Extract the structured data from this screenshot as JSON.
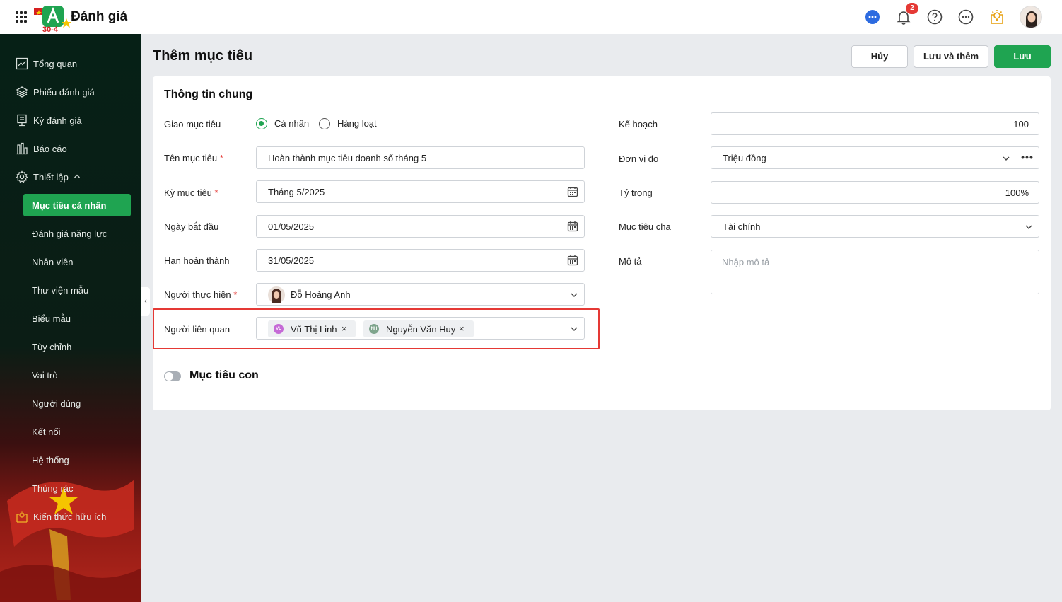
{
  "app": {
    "title": "Đánh giá",
    "logo_text": "30-4"
  },
  "topbar": {
    "notification_count": "2",
    "icons": [
      "chat-icon",
      "bell-icon",
      "help-icon",
      "more-icon",
      "lightbulb-icon"
    ]
  },
  "sidebar": {
    "items": [
      {
        "label": "Tổng quan",
        "icon": "chart-icon"
      },
      {
        "label": "Phiếu đánh giá",
        "icon": "layers-icon"
      },
      {
        "label": "Kỳ đánh giá",
        "icon": "period-icon"
      },
      {
        "label": "Báo cáo",
        "icon": "report-icon"
      },
      {
        "label": "Thiết lập",
        "icon": "gear-icon"
      }
    ],
    "sub_items": [
      {
        "label": "Mục tiêu cá nhân",
        "active": true
      },
      {
        "label": "Đánh giá năng lực"
      },
      {
        "label": "Nhân viên"
      },
      {
        "label": "Thư viện mẫu"
      },
      {
        "label": "Biểu mẫu"
      },
      {
        "label": "Tùy chỉnh"
      },
      {
        "label": "Vai trò"
      },
      {
        "label": "Người dùng"
      },
      {
        "label": "Kết nối"
      },
      {
        "label": "Hệ thống"
      },
      {
        "label": "Thùng rác"
      }
    ],
    "footer_item": {
      "label": "Kiến thức hữu ích",
      "icon": "lightbulb-icon"
    }
  },
  "header": {
    "title": "Thêm mục tiêu",
    "cancel_label": "Hủy",
    "save_add_label": "Lưu và thêm",
    "save_label": "Lưu"
  },
  "form": {
    "section_title": "Thông tin chung",
    "assign": {
      "label": "Giao mục tiêu",
      "option_individual": "Cá nhân",
      "option_bulk": "Hàng loạt",
      "selected": "Cá nhân"
    },
    "name": {
      "label": "Tên mục tiêu",
      "required": "*",
      "value": "Hoàn thành mục tiêu doanh số tháng 5"
    },
    "period": {
      "label": "Kỳ mục tiêu",
      "required": "*",
      "value": "Tháng 5/2025"
    },
    "start_date": {
      "label": "Ngày bắt đầu",
      "value": "01/05/2025"
    },
    "due_date": {
      "label": "Hạn hoàn thành",
      "value": "31/05/2025"
    },
    "assignee": {
      "label": "Người thực hiện",
      "required": "*",
      "value": "Đỗ Hoàng Anh"
    },
    "related": {
      "label": "Người liên quan",
      "people": [
        {
          "initials": "VL",
          "name": "Vũ Thị Linh",
          "color": "#c56ad6"
        },
        {
          "initials": "NH",
          "name": "Nguyễn Văn Huy",
          "color": "#7fa58d"
        }
      ]
    },
    "plan": {
      "label": "Kế hoạch",
      "value": "100"
    },
    "unit": {
      "label": "Đơn vị đo",
      "value": "Triệu đồng"
    },
    "weight": {
      "label": "Tỷ trọng",
      "value": "100%"
    },
    "parent": {
      "label": "Mục tiêu cha",
      "value": "Tài chính"
    },
    "description": {
      "label": "Mô tả",
      "placeholder": "Nhập mô tả"
    },
    "sub_goals": {
      "label": "Mục tiêu con",
      "enabled": false
    }
  },
  "colors": {
    "accent": "#1fa451",
    "highlight": "#e53935",
    "sidebar_bg": "#062016"
  }
}
